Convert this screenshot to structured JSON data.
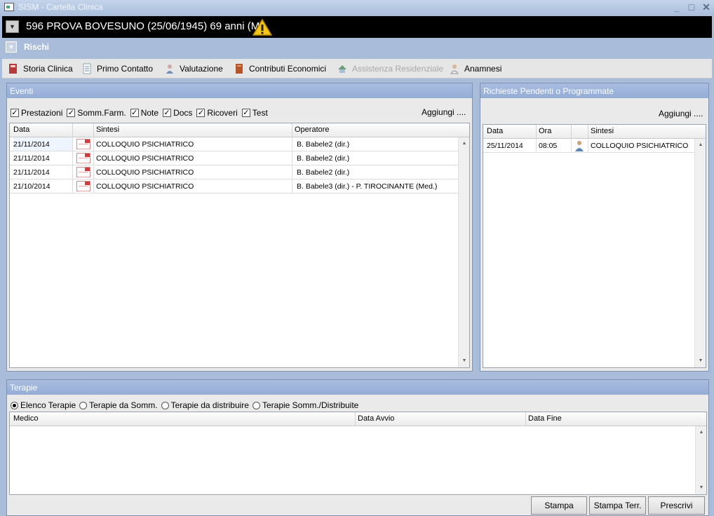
{
  "window": {
    "title": "SISM - Cartella Clinica",
    "minimize": "_",
    "maximize": "□",
    "close": "✕"
  },
  "patient": {
    "label": "596 PROVA BOVESUNO (25/06/1945) 69 anni (M)"
  },
  "rischi": {
    "label": "Rischi"
  },
  "toolbar": {
    "items": [
      {
        "label": "Storia Clinica",
        "icon": "book-icon"
      },
      {
        "label": "Primo Contatto",
        "icon": "document-icon"
      },
      {
        "label": "Valutazione",
        "icon": "person-icon"
      },
      {
        "label": "Contributi Economici",
        "icon": "folder-icon"
      },
      {
        "label": "Assistenza Residenziale",
        "icon": "residence-icon",
        "disabled": true
      },
      {
        "label": "Anamnesi",
        "icon": "doctor-icon"
      }
    ]
  },
  "eventi": {
    "title": "Eventi",
    "filters": [
      "Prestazioni",
      "Somm.Farm.",
      "Note",
      "Docs",
      "Ricoveri",
      "Test"
    ],
    "add_label": "Aggiungi ....",
    "columns": [
      "Data",
      "",
      "Sintesi",
      "Operatore"
    ],
    "rows": [
      {
        "data": "21/11/2014",
        "sintesi": "COLLOQUIO PSICHIATRICO",
        "operatore": "B. Babele2 (dir.)"
      },
      {
        "data": "21/11/2014",
        "sintesi": "COLLOQUIO PSICHIATRICO",
        "operatore": "B. Babele2 (dir.)"
      },
      {
        "data": "21/11/2014",
        "sintesi": "COLLOQUIO PSICHIATRICO",
        "operatore": "B. Babele2 (dir.)"
      },
      {
        "data": "21/10/2014",
        "sintesi": "COLLOQUIO PSICHIATRICO",
        "operatore": "B. Babele3 (dir.) -  P. TIROCINANTE (Med.)"
      }
    ]
  },
  "richieste": {
    "title": "Richieste Pendenti o Programmate",
    "add_label": "Aggiungi ....",
    "columns": [
      "Data",
      "Ora",
      "",
      "Sintesi"
    ],
    "rows": [
      {
        "data": "25/11/2014",
        "ora": "08:05",
        "sintesi": "COLLOQUIO PSICHIATRICO"
      }
    ]
  },
  "terapie": {
    "title": "Terapie",
    "radios": [
      "Elenco Terapie",
      "Terapie da Somm.",
      "Terapie da distribuire",
      "Terapie Somm./Distribuite"
    ],
    "selected": "Elenco Terapie",
    "columns": [
      "Medico",
      "Data Avvio",
      "Data Fine"
    ]
  },
  "buttons": {
    "stampa": "Stampa",
    "stampa_terr": "Stampa Terr.",
    "prescrivi": "Prescrivi"
  },
  "colors": {
    "background": "#a9bcd9",
    "header": "#95acd5",
    "patient_bar": "#000000",
    "doc_icon_red": "#d43a3a"
  }
}
